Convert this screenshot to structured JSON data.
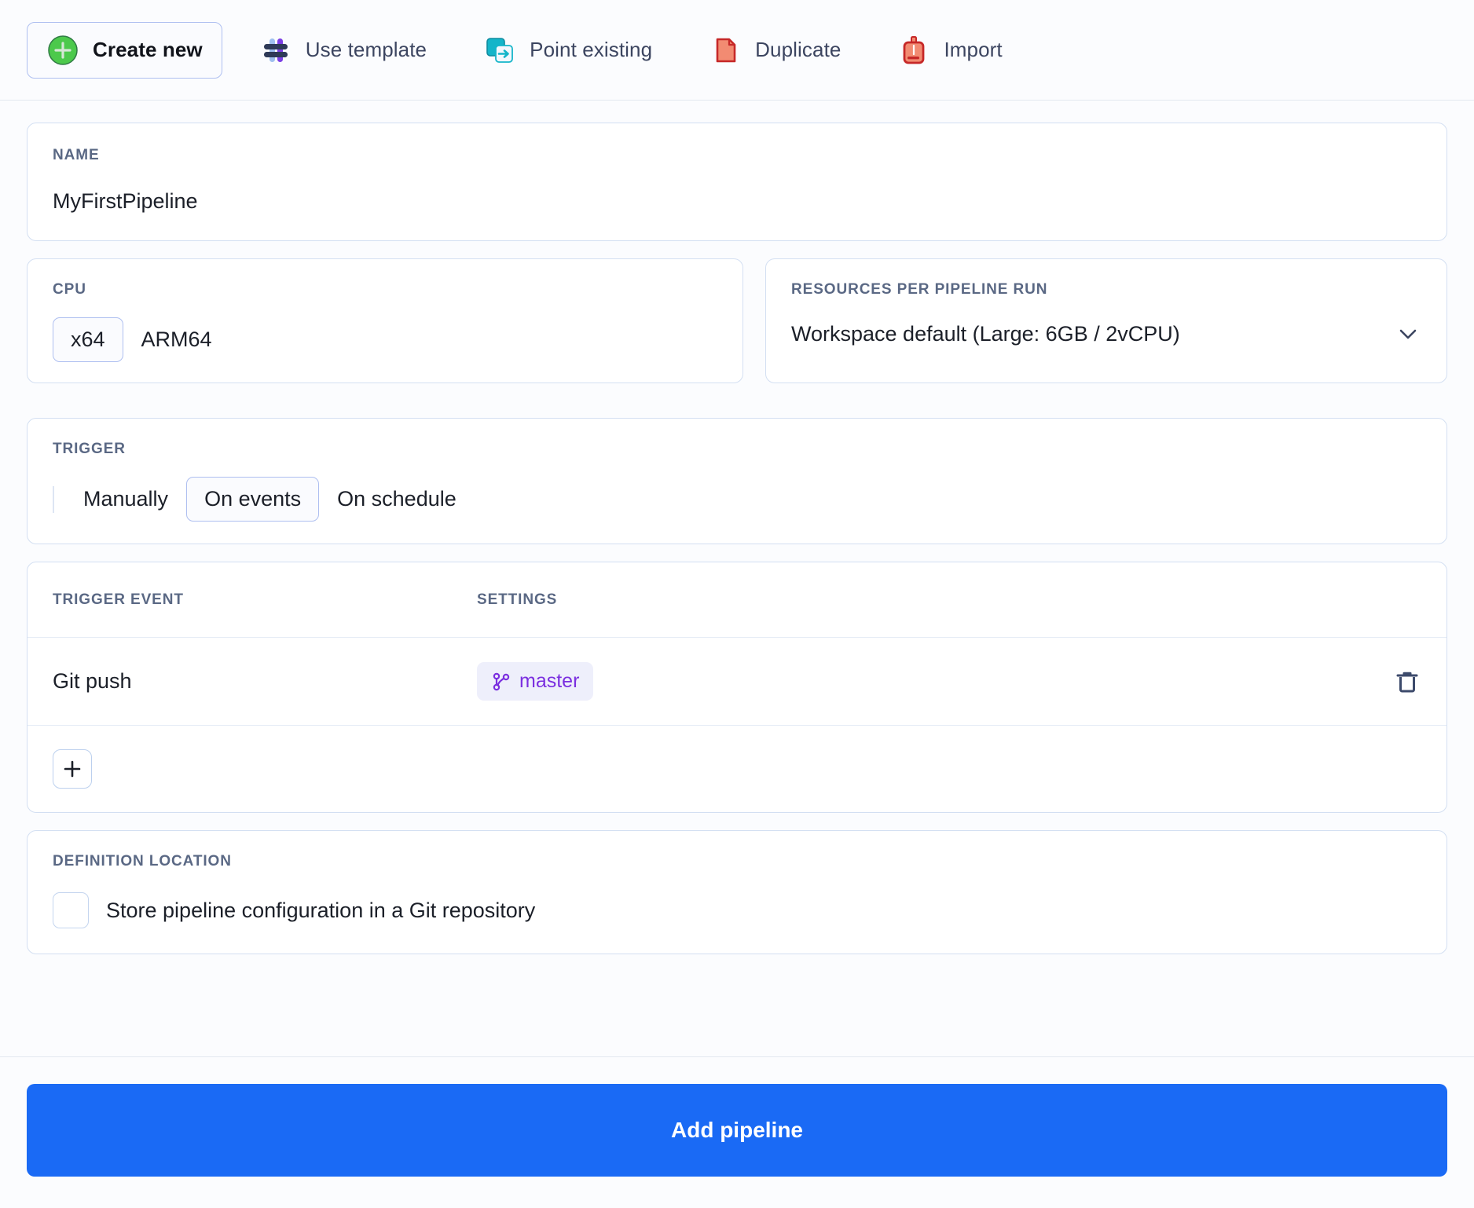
{
  "toolbar": {
    "tabs": [
      {
        "label": "Create new",
        "icon": "plus-circle-icon",
        "active": true
      },
      {
        "label": "Use template",
        "icon": "template-grid-icon",
        "active": false
      },
      {
        "label": "Point existing",
        "icon": "point-existing-icon",
        "active": false
      },
      {
        "label": "Duplicate",
        "icon": "duplicate-page-icon",
        "active": false
      },
      {
        "label": "Import",
        "icon": "import-box-icon",
        "active": false
      }
    ]
  },
  "name_section": {
    "label": "NAME",
    "value": "MyFirstPipeline"
  },
  "cpu_section": {
    "label": "CPU",
    "options": [
      "x64",
      "ARM64"
    ],
    "selected": "x64"
  },
  "resources_section": {
    "label": "RESOURCES PER PIPELINE RUN",
    "selected": "Workspace default (Large: 6GB / 2vCPU)",
    "chevron": "chevron-down-icon"
  },
  "trigger_section": {
    "label": "TRIGGER",
    "options": [
      "Manually",
      "On events",
      "On schedule"
    ],
    "selected": "On events"
  },
  "events_table": {
    "columns": [
      "TRIGGER EVENT",
      "SETTINGS"
    ],
    "rows": [
      {
        "event": "Git push",
        "setting_badge": "master",
        "badge_icon": "git-branch-icon",
        "delete_icon": "trash-icon"
      }
    ],
    "add_label": "+"
  },
  "definition_section": {
    "label": "DEFINITION LOCATION",
    "checkbox_label": "Store pipeline configuration in a Git repository",
    "checked": false
  },
  "footer": {
    "submit_label": "Add pipeline"
  },
  "colors": {
    "primary": "#1a6af5",
    "accent_border": "#aebff0",
    "label_text": "#5a6884",
    "badge_text": "#7b2fe0",
    "badge_bg": "#eeeffb",
    "create_icon_green": "#4cc94c",
    "template_purple": "#7b3fe4",
    "point_existing_teal": "#15b5c9",
    "duplicate_red": "#c62828",
    "duplicate_fill": "#f28b72"
  }
}
